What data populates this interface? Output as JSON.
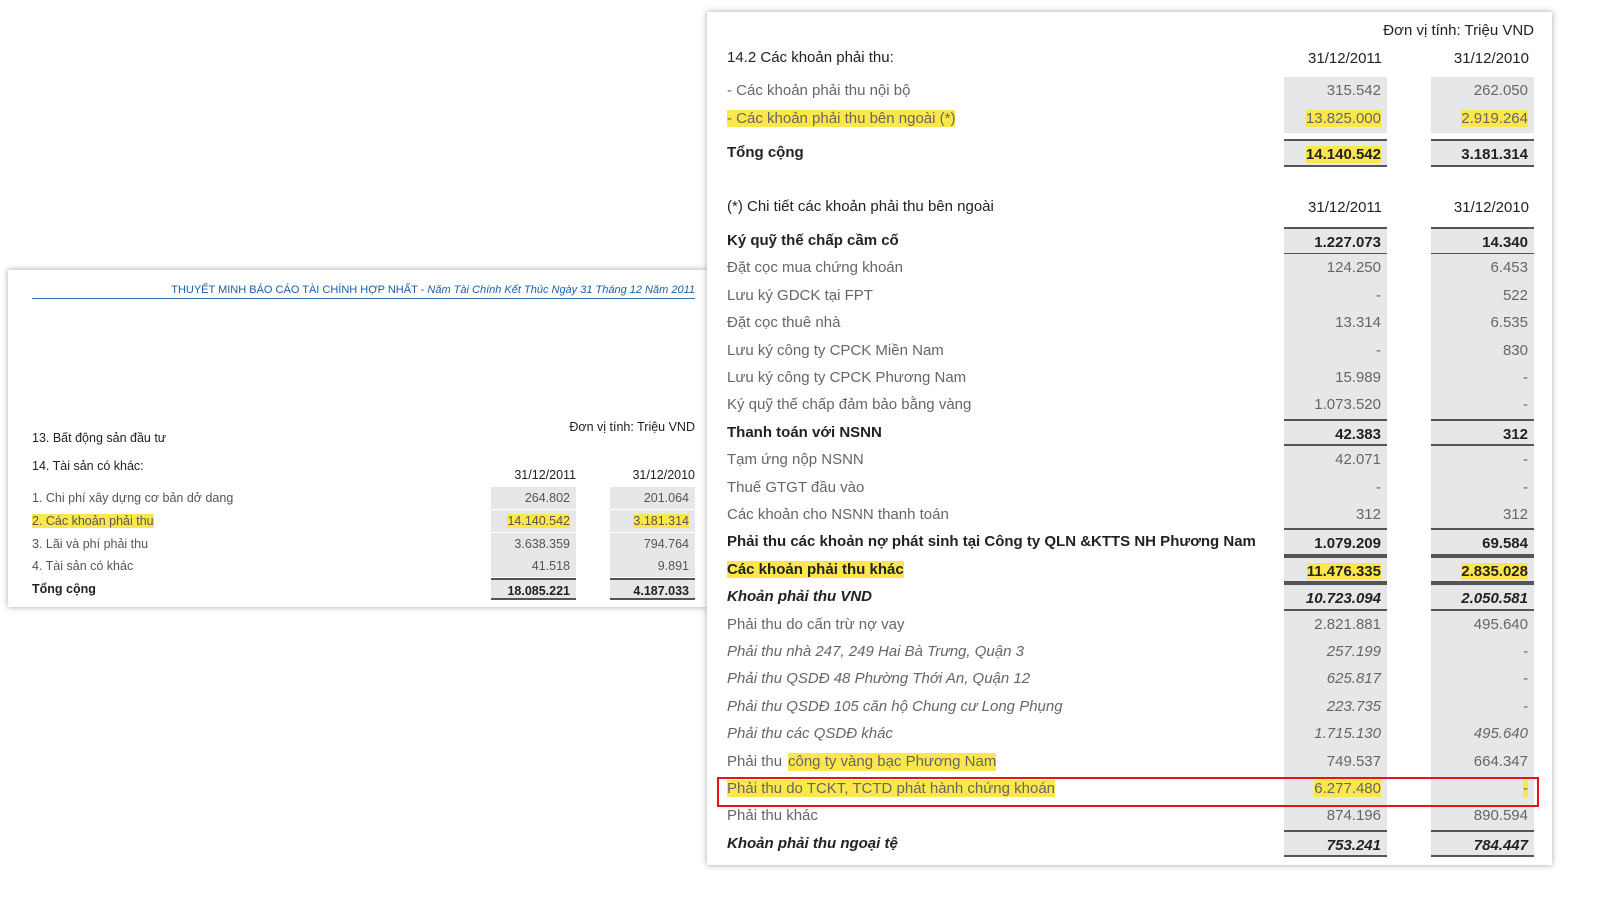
{
  "left": {
    "header_main": "THUYẾT MINH BÁO CÁO TÀI CHÍNH HỢP NHẤT - ",
    "header_italic": "Năm Tài Chính Kết Thúc Ngày 31 Tháng 12 Năm 2011",
    "unit": "Đơn vị tính: Triệu VND",
    "section13": "13. Bất động sản đầu tư",
    "section14": "14. Tài sản có khác:",
    "col1": "31/12/2011",
    "col2": "31/12/2010",
    "rows": [
      {
        "label": "1. Chi phí xây dựng cơ bản dở dang",
        "v1": "264.802",
        "v2": "201.064",
        "style": ""
      },
      {
        "label": "2. Các khoản phải thu",
        "v1": "14.140.542",
        "v2": "3.181.314",
        "style": "hl"
      },
      {
        "label": " 3. Lãi và phí phải thu",
        "v1": "3.638.359",
        "v2": "794.764",
        "style": ""
      },
      {
        "label": "4. Tài sản có khác",
        "v1": "41.518",
        "v2": "9.891",
        "style": ""
      },
      {
        "label": "Tổng cộng",
        "v1": "18.085.221",
        "v2": "4.187.033",
        "style": "total"
      }
    ]
  },
  "right": {
    "unit": "Đơn vị tính: Triệu VND",
    "title": "14.2  Các khoản phải thu:",
    "col1": "31/12/2011",
    "col2": "31/12/2010",
    "detail_title": "(*) Chi tiết các khoản phải thu bên ngoài",
    "rows": [
      {
        "label": "- Các khoản phải thu nội bộ",
        "v1": "315.542",
        "v2": "262.050",
        "style": ""
      },
      {
        "label": "- Các khoản phải thu bên ngoài (*)",
        "v1": "13.825.000",
        "v2": "2.919.264",
        "style": "hl"
      },
      {
        "label": "Tổng cộng",
        "v1": "14.140.542",
        "v2": "3.181.314",
        "style": "bold-total-hl1"
      }
    ],
    "detail_rows": [
      {
        "label": "Ký quỹ thế chấp cầm cố",
        "v1": "1.227.073",
        "v2": "14.340",
        "style": "bold"
      },
      {
        "label": "Đặt cọc mua chứng khoán",
        "v1": "124.250",
        "v2": "6.453",
        "style": ""
      },
      {
        "label": "Lưu ký GDCK tại FPT",
        "v1": "-",
        "v2": "522",
        "style": ""
      },
      {
        "label": "Đặt cọc thuê nhà",
        "v1": "13.314",
        "v2": "6.535",
        "style": ""
      },
      {
        "label": "Lưu ký công ty CPCK Miền Nam",
        "v1": "-",
        "v2": "830",
        "style": ""
      },
      {
        "label": "Lưu ký công ty CPCK Phương Nam",
        "v1": "15.989",
        "v2": "-",
        "style": ""
      },
      {
        "label": "Ký quỹ thế chấp đảm bảo bằng vàng",
        "v1": "1.073.520",
        "v2": "-",
        "style": ""
      },
      {
        "label": "Thanh toán với NSNN",
        "v1": "42.383",
        "v2": "312",
        "style": "bold"
      },
      {
        "label": "Tạm ứng nộp NSNN",
        "v1": "42.071",
        "v2": "-",
        "style": ""
      },
      {
        "label": "Thuế GTGT đầu vào",
        "v1": "-",
        "v2": "-",
        "style": ""
      },
      {
        "label": "Các khoản cho NSNN thanh toán",
        "v1": "312",
        "v2": "312",
        "style": ""
      },
      {
        "label": "Phải thu các khoản nợ phát sinh tại Công ty QLN &KTTS NH Phương Nam",
        "v1": "1.079.209",
        "v2": "69.584",
        "style": "bold"
      },
      {
        "label": "Các khoản phải thu khác",
        "v1": "11.476.335",
        "v2": "2.835.028",
        "style": "bold-hl"
      },
      {
        "label": "Khoản phải thu VND",
        "v1": "10.723.094",
        "v2": "2.050.581",
        "style": "bi"
      },
      {
        "label": "Phải thu do cấn trừ nợ vay",
        "v1": "2.821.881",
        "v2": "495.640",
        "style": ""
      },
      {
        "label": "Phải thu nhà 247, 249 Hai Bà Trưng, Quận 3",
        "v1": "257.199",
        "v2": "-",
        "style": "it"
      },
      {
        "label": "Phải thu QSDĐ 48 Phường Thới An, Quận 12",
        "v1": "625.817",
        "v2": "-",
        "style": "it"
      },
      {
        "label": "Phải thu QSDĐ 105 căn hộ Chung cư Long Phụng",
        "v1": "223.735",
        "v2": "-",
        "style": "it"
      },
      {
        "label": "Phải thu các QSDĐ khác",
        "v1": "1.715.130",
        "v2": "495.640",
        "style": "it"
      },
      {
        "label": "Phải thu ",
        "label_hl": "công ty vàng bạc Phương Nam",
        "v1": "749.537",
        "v2": "664.347",
        "style": "parthl"
      },
      {
        "label": "Phải thu do TCKT, TCTD phát hành chứng khoán",
        "v1": "6.277.480",
        "v2": "-",
        "style": "hl"
      },
      {
        "label": "Phải thu khác",
        "v1": "874.196",
        "v2": "890.594",
        "style": ""
      },
      {
        "label": "Khoản phải thu ngoại tệ",
        "v1": "753.241",
        "v2": "784.447",
        "style": "bi"
      }
    ]
  },
  "colors": {
    "highlight": "#fde74c",
    "red_box": "#e8141b",
    "header_blue": "#1b5fb0",
    "cell_bg": "#e6e7e8"
  }
}
